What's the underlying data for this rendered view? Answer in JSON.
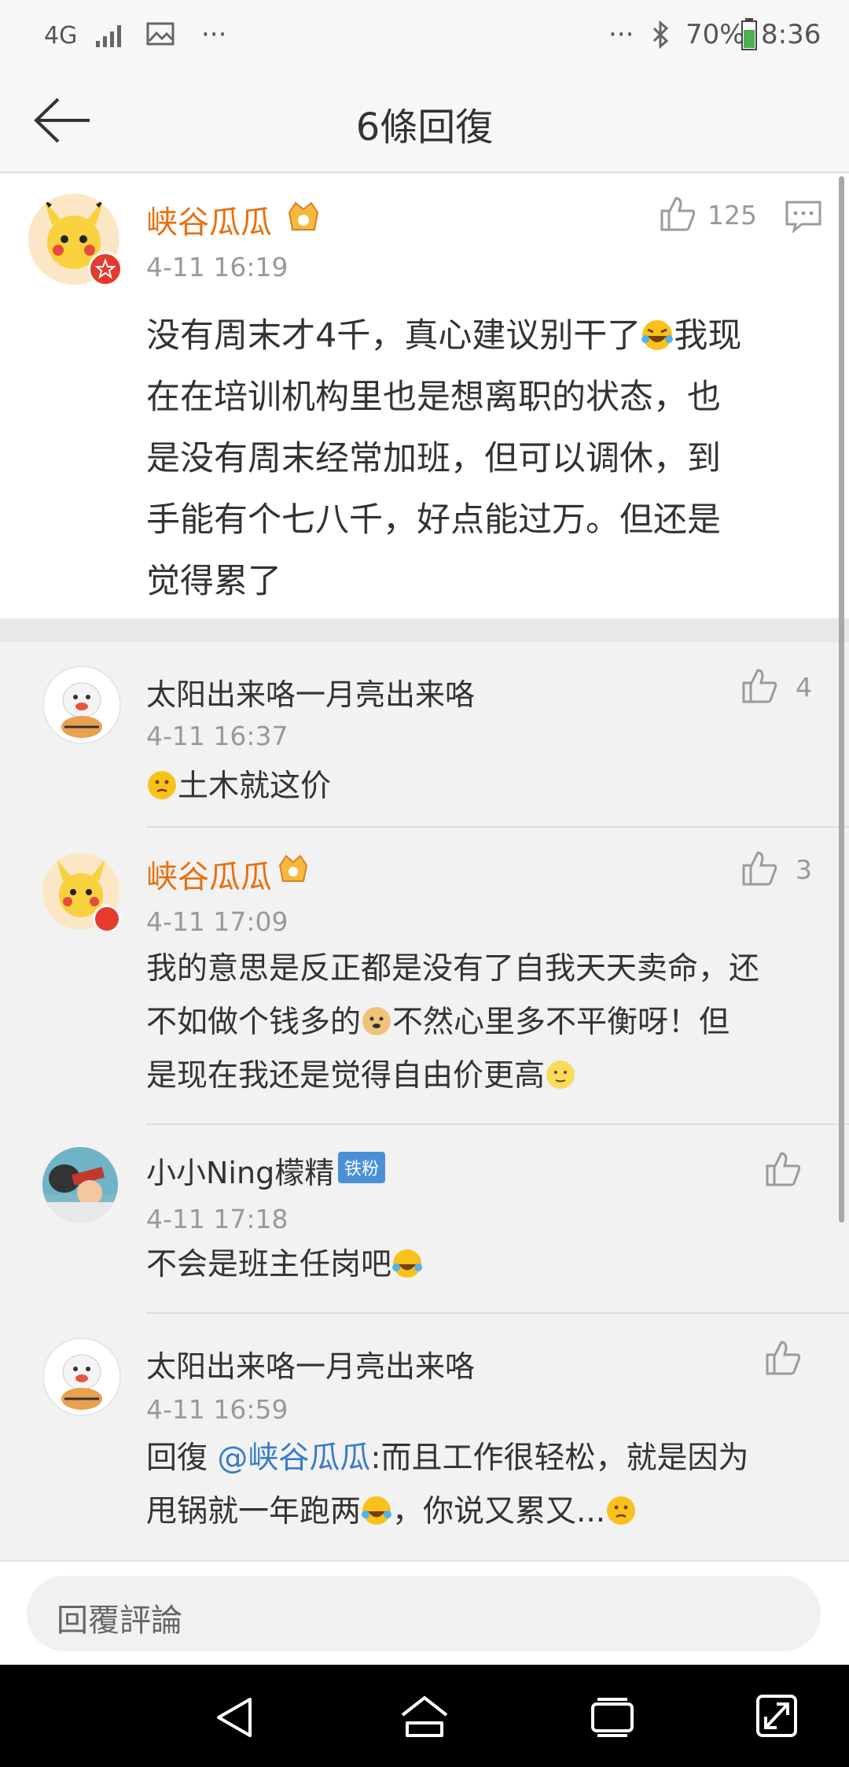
{
  "status_bar": {
    "network": "4G",
    "battery": "70%",
    "time": "8:36",
    "dots": "···",
    "dots_right": "···"
  },
  "header": {
    "title": "6條回復"
  },
  "main_comment": {
    "username": "峡谷瓜瓜",
    "time": "4-11 16:19",
    "likes": "125",
    "text_lines": [
      "没有周末才4千，真心建议别干了",
      "我现",
      "在在培训机构里也是想离职的状态，也",
      "是没有周末经常加班，但可以调休，到",
      "手能有个七八千，好点能过万。但还是",
      "觉得累了"
    ]
  },
  "replies": [
    {
      "username": "太阳出来咯一月亮出来咯",
      "time": "4-11 16:37",
      "likes": "4",
      "text": "土木就这价"
    },
    {
      "username": "峡谷瓜瓜",
      "time": "4-11 17:09",
      "likes": "3",
      "lines": [
        "我的意思是反正都是没有了自我天天卖命，还",
        "不如做个钱多的",
        "不然心里多不平衡呀！但",
        "是现在我还是觉得自由价更高"
      ]
    },
    {
      "username": "小小Ning檬精",
      "badge": "铁粉",
      "time": "4-11 17:18",
      "likes": "",
      "text": "不会是班主任岗吧"
    },
    {
      "username": "太阳出来咯一月亮出来咯",
      "time": "4-11 16:59",
      "likes": "",
      "prefix": "回復 ",
      "mention": "@峡谷瓜瓜",
      "line1_rest": ":而且工作很轻松，就是因为",
      "line2_a": "甩锅就一年跑两",
      "line2_b": "，你说又累又..."
    }
  ],
  "input": {
    "placeholder": "回覆評論"
  },
  "colors": {
    "accent_name": "#e8700f",
    "mention": "#3a7cc8",
    "muted": "#999999"
  },
  "icons": [
    "back-arrow-icon",
    "thumbs-up-icon",
    "comment-icon",
    "vip-crown-icon",
    "nav-back-icon",
    "nav-home-icon",
    "nav-recents-icon",
    "nav-expand-icon"
  ]
}
